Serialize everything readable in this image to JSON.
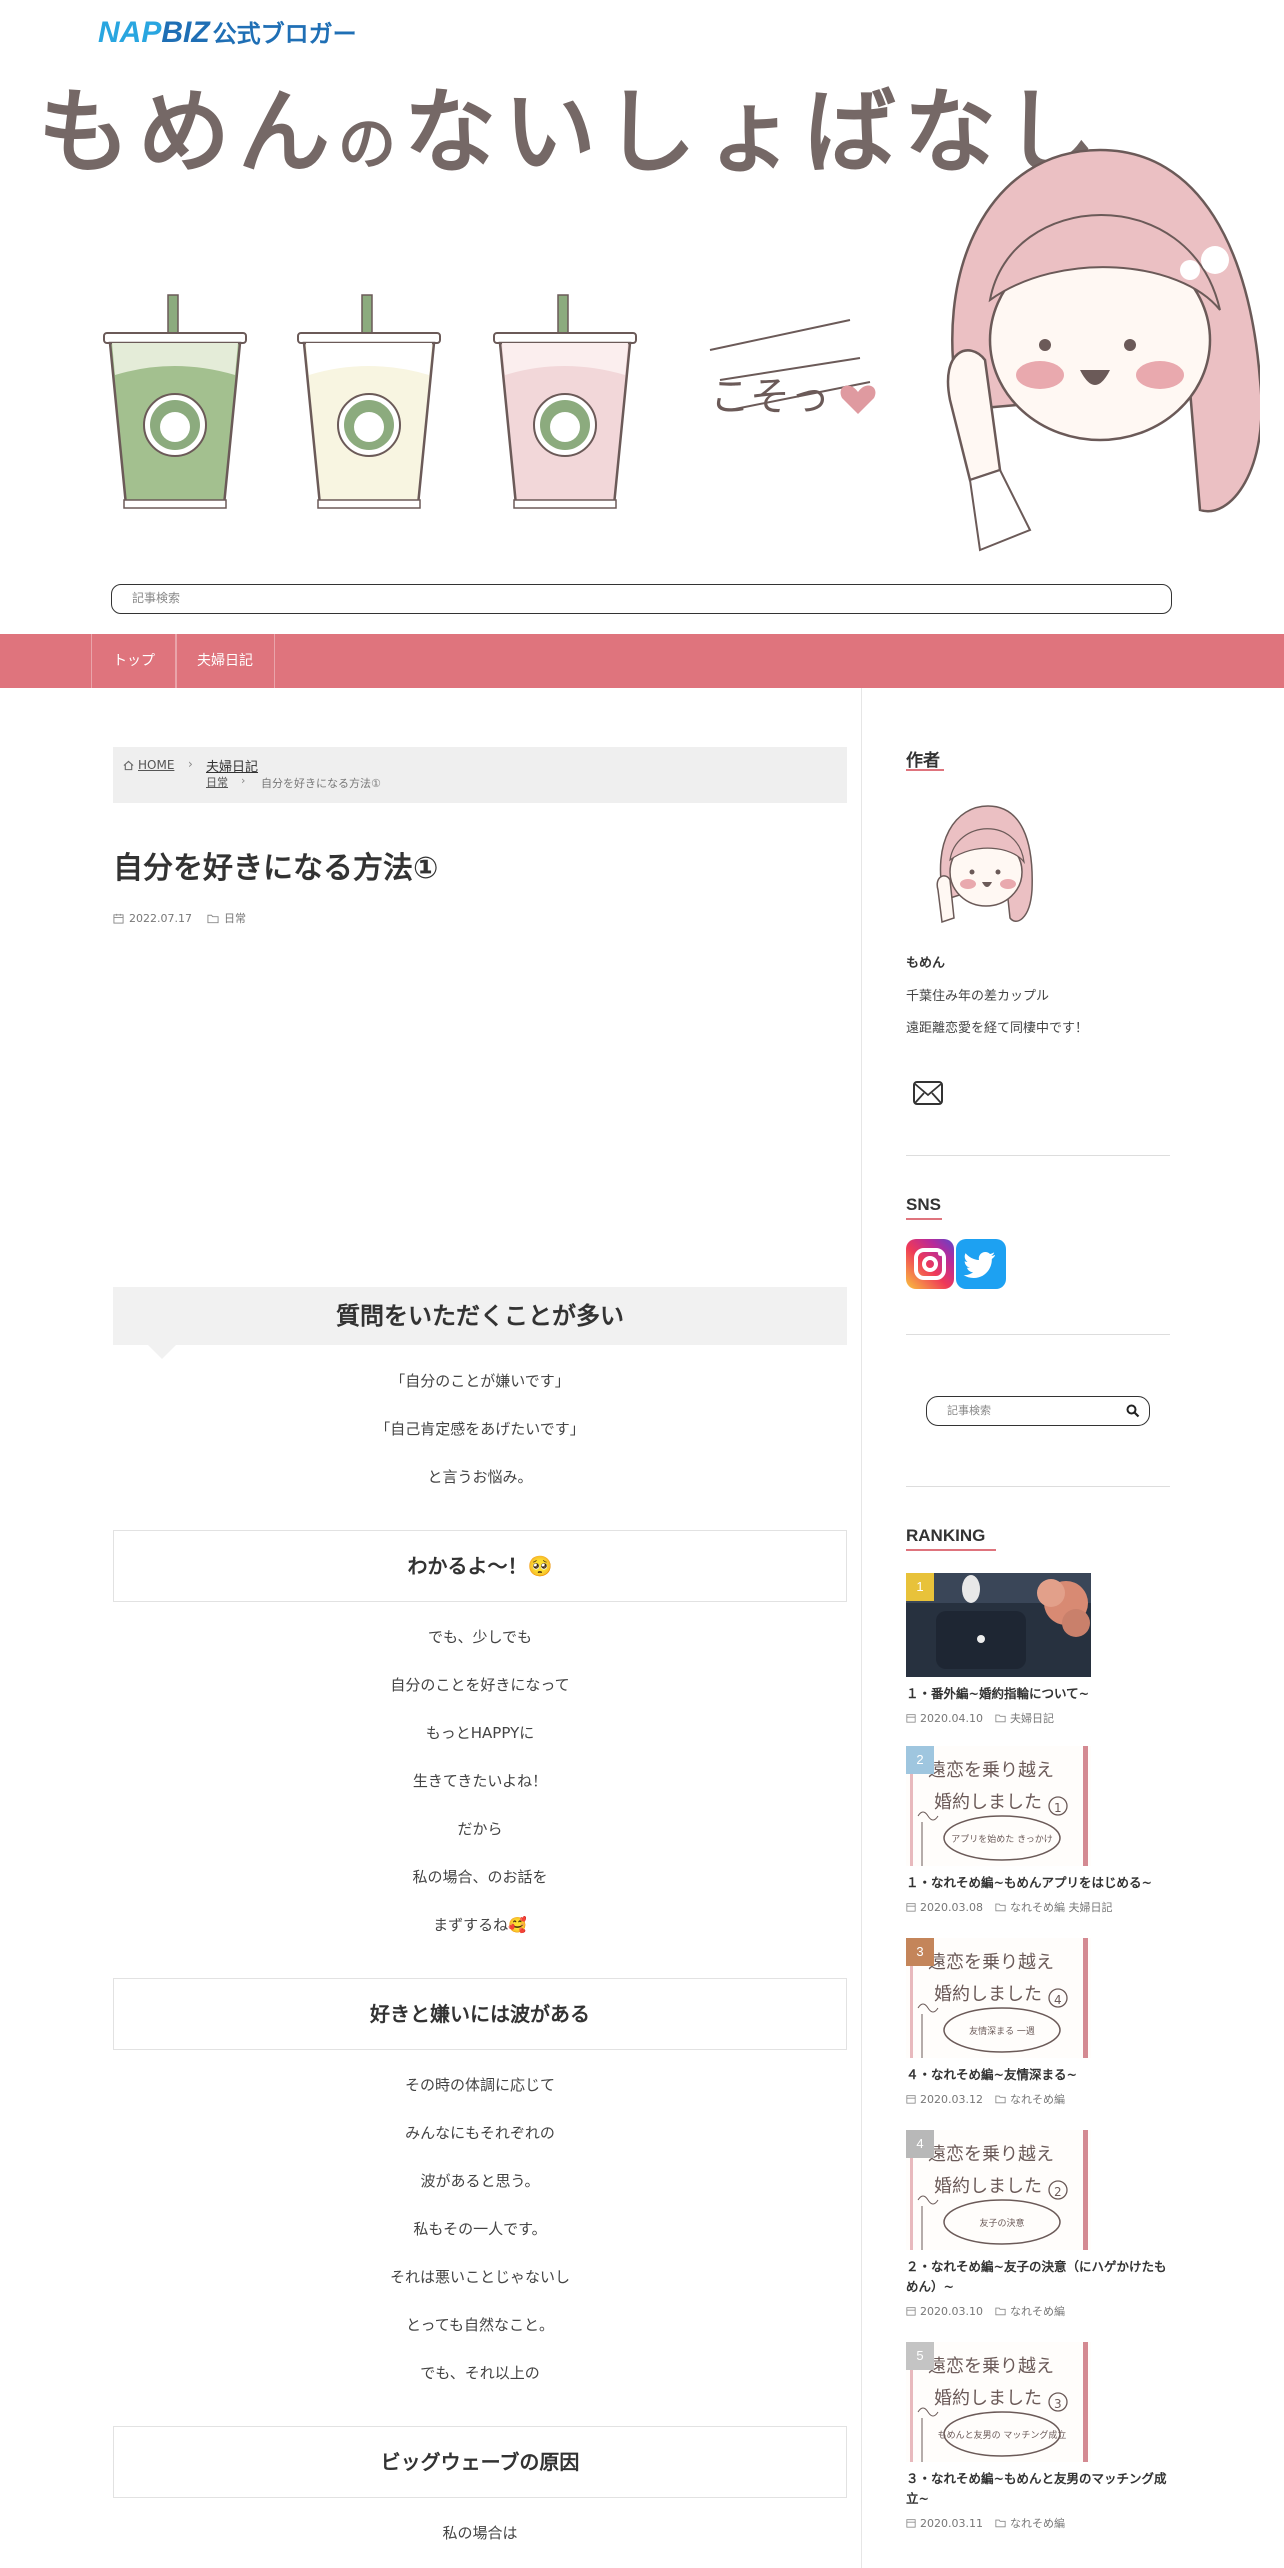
{
  "header": {
    "napbiz": {
      "nap": "NAP",
      "biz": "BIZ",
      "blogger": "公式ブロガー"
    },
    "site_title_a": "もめん",
    "site_title_no": "の",
    "site_title_b": "ないしょばなし",
    "art_text": "こそっ",
    "search_placeholder": "記事検索"
  },
  "nav": {
    "items": [
      {
        "label": "トップ"
      },
      {
        "label": "夫婦日記"
      }
    ]
  },
  "breadcrumb": {
    "home": "HOME",
    "category": "夫婦日記",
    "subcategory": "日常",
    "current": "自分を好きになる方法①"
  },
  "post": {
    "title": "自分を好きになる方法①",
    "date": "2022.07.17",
    "category": "日常",
    "h2": "質問をいただくことが多い",
    "intro": [
      "「自分のことが嫌いです」",
      "「自己肯定感をあげたいです」",
      "と言うお悩み。"
    ],
    "h3_1": "わかるよ〜！🥺",
    "sec1": [
      "でも、少しでも",
      "自分のことを好きになって",
      "もっとHAPPYに",
      "生きてきたいよね！",
      "だから",
      "私の場合、のお話を",
      "まずするね🥰"
    ],
    "h3_2": "好きと嫌いには波がある",
    "sec2": [
      "その時の体調に応じて",
      "みんなにもそれぞれの",
      "波があると思う。",
      "私もその一人です。",
      "それは悪いことじゃないし",
      "とっても自然なこと。",
      "でも、それ以上の"
    ],
    "h3_3": "ビッグウェーブの原因",
    "sec3": [
      "私の場合は"
    ]
  },
  "sidebar": {
    "author_heading": "作者",
    "author_name": "もめん",
    "author_bio": [
      "千葉住み年の差カップル",
      "遠距離恋愛を経て同棲中です！"
    ],
    "sns_heading": "SNS",
    "search_placeholder": "記事検索",
    "ranking_heading": "RANKING",
    "ranking": [
      {
        "rank": "1",
        "title": "１・番外編~婚約指輪について~",
        "date": "2020.04.10",
        "category": "夫婦日記",
        "color": "#e8c23a",
        "thumb": "photo"
      },
      {
        "rank": "2",
        "title": "１・なれそめ編~もめんアプリをはじめる~",
        "date": "2020.03.08",
        "category": "なれそめ編 夫婦日記",
        "color": "#9fc6df",
        "thumb": "ill",
        "thumb_no": "1",
        "thumb_sub": "アプリを始めた きっかけ"
      },
      {
        "rank": "3",
        "title": "４・なれそめ編~友情深まる~",
        "date": "2020.03.12",
        "category": "なれそめ編",
        "color": "#c4855a",
        "thumb": "ill",
        "thumb_no": "4",
        "thumb_sub": "友情深まる 一週"
      },
      {
        "rank": "4",
        "title": "２・なれそめ編~友子の決意（にハゲかけたもめん）~",
        "date": "2020.03.10",
        "category": "なれそめ編",
        "color": "#b8b8b8",
        "thumb": "ill",
        "thumb_no": "2",
        "thumb_sub": "友子の決意"
      },
      {
        "rank": "5",
        "title": "３・なれそめ編~もめんと友男のマッチング成立~",
        "date": "2020.03.11",
        "category": "なれそめ編",
        "color": "#c4c4c4",
        "thumb": "ill",
        "thumb_no": "3",
        "thumb_sub": "もめんと友男の マッチング成立"
      }
    ],
    "thumb_title": [
      "遠恋を乗り越え",
      "婚約しました"
    ]
  },
  "colors": {
    "accent": "#df747d",
    "title_brown": "#756866",
    "napbiz_blue": "#29a6e0"
  }
}
